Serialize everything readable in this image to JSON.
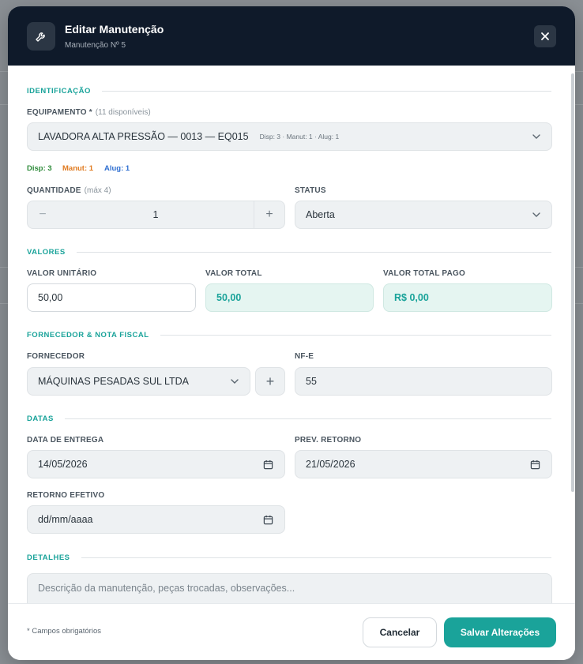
{
  "header": {
    "title": "Editar Manutenção",
    "subtitle": "Manutenção Nº 5"
  },
  "sections": {
    "identificacao": "IDENTIFICAÇÃO",
    "valores": "VALORES",
    "fornecedor": "FORNECEDOR & NOTA FISCAL",
    "datas": "DATAS",
    "detalhes": "DETALHES"
  },
  "equipamento": {
    "label": "EQUIPAMENTO *",
    "available": "(11 disponíveis)",
    "value": "LAVADORA ALTA PRESSÃO — 0013 — EQ015",
    "inline_stats": "Disp: 3 · Manut: 1 · Alug: 1",
    "disp": "Disp: 3",
    "manut": "Manut: 1",
    "alug": "Alug: 1"
  },
  "quantidade": {
    "label": "QUANTIDADE",
    "max": "(máx 4)",
    "value": "1",
    "minus": "−",
    "plus": "+"
  },
  "status": {
    "label": "STATUS",
    "value": "Aberta"
  },
  "valor_unitario": {
    "label": "VALOR UNITÁRIO",
    "value": "50,00"
  },
  "valor_total": {
    "label": "VALOR TOTAL",
    "value": "50,00"
  },
  "valor_total_pago": {
    "label": "VALOR TOTAL PAGO",
    "value": "R$ 0,00"
  },
  "fornecedor": {
    "label": "FORNECEDOR",
    "value": "MÁQUINAS PESADAS SUL LTDA",
    "add": "+"
  },
  "nfe": {
    "label": "NF-E",
    "value": "55"
  },
  "data_entrega": {
    "label": "DATA DE ENTREGA",
    "value": "14/05/2026"
  },
  "prev_retorno": {
    "label": "PREV. RETORNO",
    "value": "21/05/2026"
  },
  "retorno_efetivo": {
    "label": "RETORNO EFETIVO",
    "value": "dd/mm/aaaa"
  },
  "detalhes": {
    "placeholder": "Descrição da manutenção, peças trocadas, observações..."
  },
  "footer": {
    "required_note": "* Campos obrigatórios",
    "cancel": "Cancelar",
    "save": "Salvar Alterações"
  },
  "colors": {
    "accent": "#1aa39a",
    "header_bg": "#0f1a2a",
    "disp": "#2e8b3a",
    "manut": "#e07a1f",
    "alug": "#2f6fd1"
  }
}
